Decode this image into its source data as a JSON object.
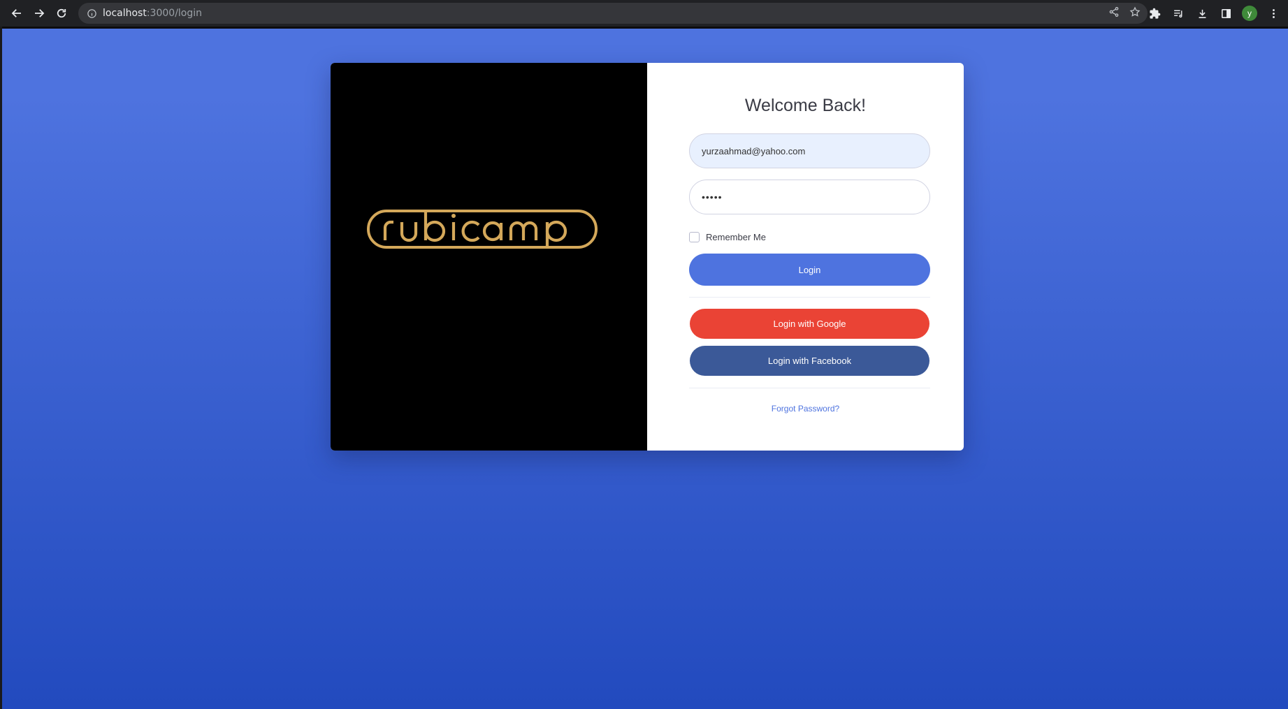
{
  "browser": {
    "url_host": "localhost",
    "url_path": ":3000/login",
    "avatar_letter": "y"
  },
  "login": {
    "title": "Welcome Back!",
    "email_value": "yurzaahmad@yahoo.com",
    "password_value": "•••••",
    "remember_label": "Remember Me",
    "remember_checked": false,
    "login_button": "Login",
    "google_button": "Login with Google",
    "facebook_button": "Login with Facebook",
    "forgot_link": "Forgot Password?"
  },
  "brand": {
    "logo_text": "rubicamp",
    "logo_color": "#d4a85a"
  },
  "colors": {
    "primary": "#4e73df",
    "google": "#ea4335",
    "facebook": "#3b5998",
    "background_top": "#4e73df",
    "background_bottom": "#224abe"
  }
}
